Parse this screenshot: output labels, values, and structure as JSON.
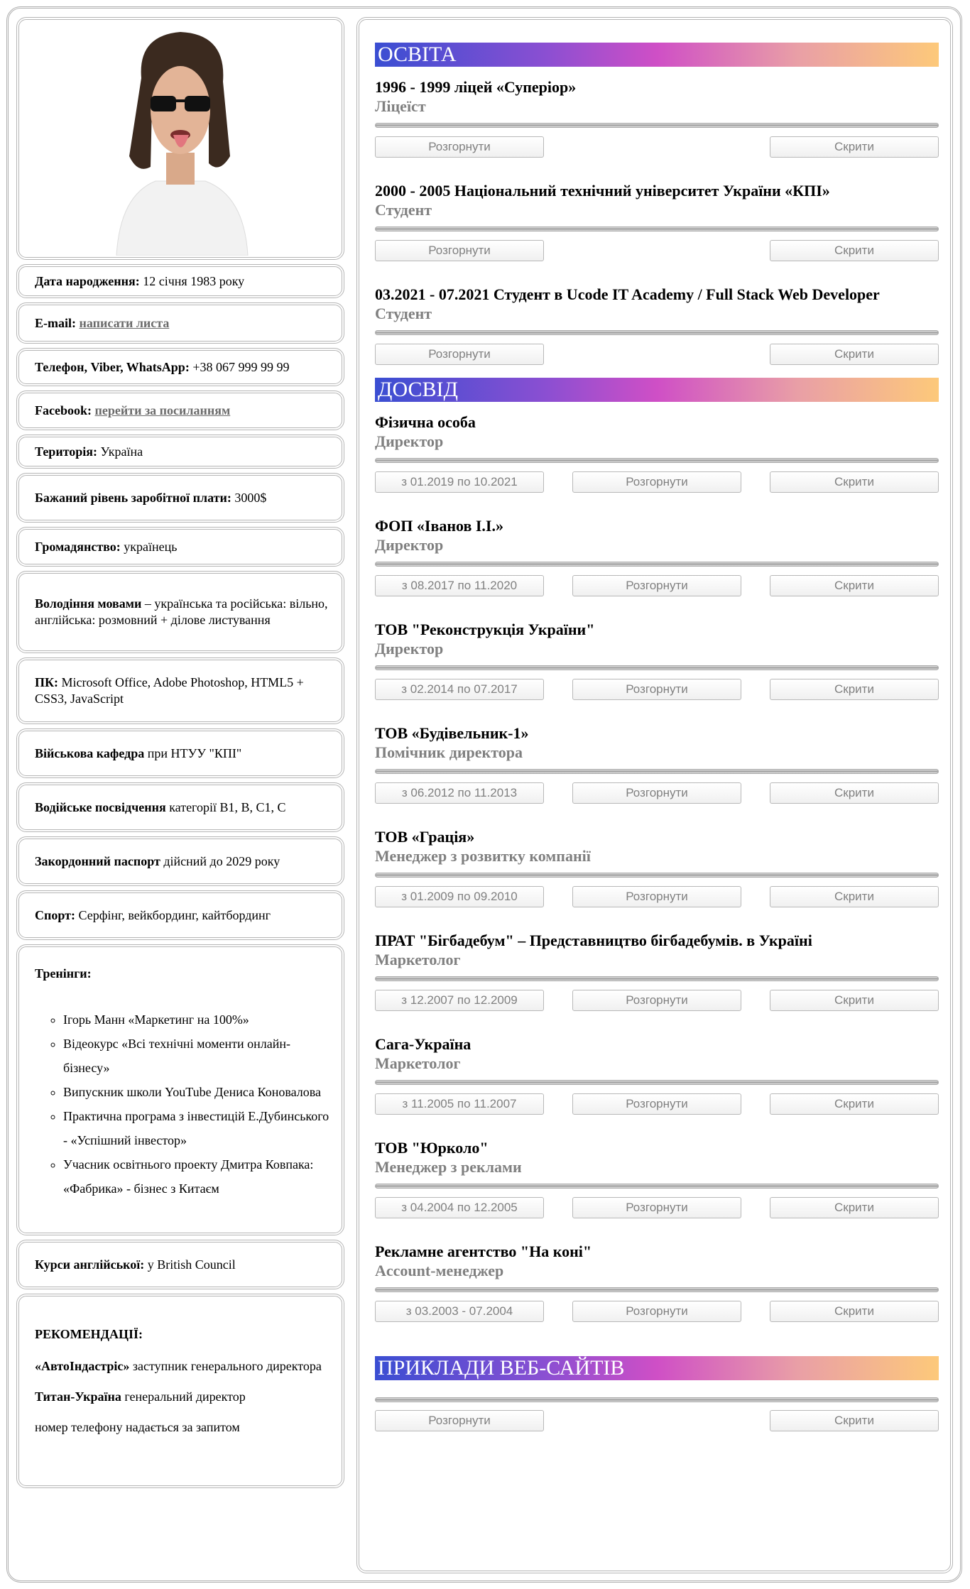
{
  "profile": {
    "birth": {
      "label": "Дата народження:",
      "value": " 12 січня 1983 року"
    },
    "email": {
      "label": "E-mail:",
      "link": "написати листа"
    },
    "phone": {
      "label": "Телефон, Viber, WhatsApp:",
      "value": " +38 067 999 99 99"
    },
    "facebook": {
      "label": "Facebook:",
      "link": "перейти за посиланням"
    },
    "territory": {
      "label": "Територія:",
      "value": " Україна"
    },
    "salary": {
      "label": "Бажаний рівень заробітної плати:",
      "value": " 3000$"
    },
    "citizenship": {
      "label": "Громадянство:",
      "value": " українець"
    },
    "languages": {
      "label": "Володіння мовами",
      "value": " – українська та російська: вільно, англійська: розмовний + ділове листування"
    },
    "pc": {
      "label": "ПК:",
      "value": " Microsoft Office, Adobe Photoshop, HTML5 + CSS3, JavaScript"
    },
    "military": {
      "label": "Військова кафедра",
      "value": " при НТУУ \"КПІ\""
    },
    "driver": {
      "label": "Водійське посвідчення",
      "value": " категорії B1, B, C1, C"
    },
    "passport": {
      "label": "Закордонний паспорт",
      "value": " дійсний до 2029 року"
    },
    "sport": {
      "label": "Спорт:",
      "value": " Серфінг, вейкбординг, кайтбординг"
    },
    "trainings": {
      "label": "Тренінги:",
      "items": [
        "Ігорь Манн «Маркетинг на 100%»",
        "Відеокурс «Всі технічні моменти онлайн-бізнесу»",
        "Випускник школи YouTube Дениса Коновалова",
        "Практична програма з інвестицій Е.Дубинського - «Успішний інвестор»",
        "Учасник освітнього проекту Дмитра Ковпака: «Фабрика» - бізнес з Китаєм"
      ]
    },
    "english": {
      "label": "Курси англійської:",
      "value": " у British Council"
    },
    "recommendations": {
      "label": "РЕКОМЕНДАЦІЇ:",
      "r1_name": "«АвтоІндастріс»",
      "r1_role": " заступник генерального директора",
      "r2_name": "Титан-Україна",
      "r2_role": " генеральний директор",
      "note": "номер телефону надається за запитом"
    }
  },
  "buttons": {
    "expand": "Розгорнути",
    "hide": "Скрити"
  },
  "education": {
    "title": "ОСВІТА",
    "items": [
      {
        "title": "1996 - 1999 ліцей «Суперіор»",
        "role": "Ліцеїст"
      },
      {
        "title": "2000 - 2005 Національний технічний університет України «КПІ»",
        "role": "Студент"
      },
      {
        "title": "03.2021 - 07.2021 Студент в Ucode IT Academy / Full Stack Web Developer",
        "role": "Студент"
      }
    ]
  },
  "experience": {
    "title": "ДОСВІД",
    "items": [
      {
        "title": "Фізична особа",
        "role": "Директор",
        "period": "з 01.2019 по 10.2021"
      },
      {
        "title": "ФОП «Іванов І.І.»",
        "role": "Директор",
        "period": "з 08.2017 по 11.2020"
      },
      {
        "title": "ТОВ \"Реконструкція України\"",
        "role": "Директор",
        "period": "з 02.2014 по 07.2017"
      },
      {
        "title": "ТОВ «Будівельник-1»",
        "role": "Помічник директора",
        "period": "з 06.2012 по 11.2013"
      },
      {
        "title": "ТОВ «Грація»",
        "role": "Менеджер з розвитку компанії",
        "period": "з 01.2009 по 09.2010"
      },
      {
        "title": "ПРАТ \"Бігбадебум\" – Представництво бігбадебумів. в Україні",
        "role": "Маркетолог",
        "period": "з 12.2007 по 12.2009"
      },
      {
        "title": "Сага-Україна",
        "role": "Маркетолог",
        "period": "з 11.2005 по 11.2007"
      },
      {
        "title": "ТОВ \"Юрколо\"",
        "role": "Менеджер з реклами",
        "period": "з 04.2004 по 12.2005"
      },
      {
        "title": "Рекламне агентство \"На коні\"",
        "role": "Account-менеджер",
        "period": "з 03.2003 - 07.2004"
      }
    ]
  },
  "websites": {
    "title": "ПРИКЛАДИ ВЕБ-САЙТІВ"
  }
}
